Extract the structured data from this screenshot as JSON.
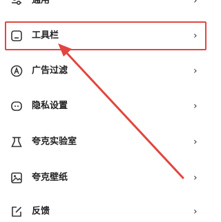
{
  "menu": {
    "items": [
      {
        "label": "通用",
        "icon": "toggle-icon"
      },
      {
        "label": "工具栏",
        "icon": "toolbar-icon"
      },
      {
        "label": "广告过滤",
        "icon": "ad-filter-icon"
      },
      {
        "label": "隐私设置",
        "icon": "privacy-icon"
      },
      {
        "label": "夸克实验室",
        "icon": "flask-icon"
      },
      {
        "label": "夸克壁纸",
        "icon": "wallpaper-icon"
      },
      {
        "label": "反馈",
        "icon": "feedback-icon"
      }
    ],
    "chevron": "›"
  },
  "annotation": {
    "color": "#e2453f",
    "highlighted_item": "工具栏"
  }
}
